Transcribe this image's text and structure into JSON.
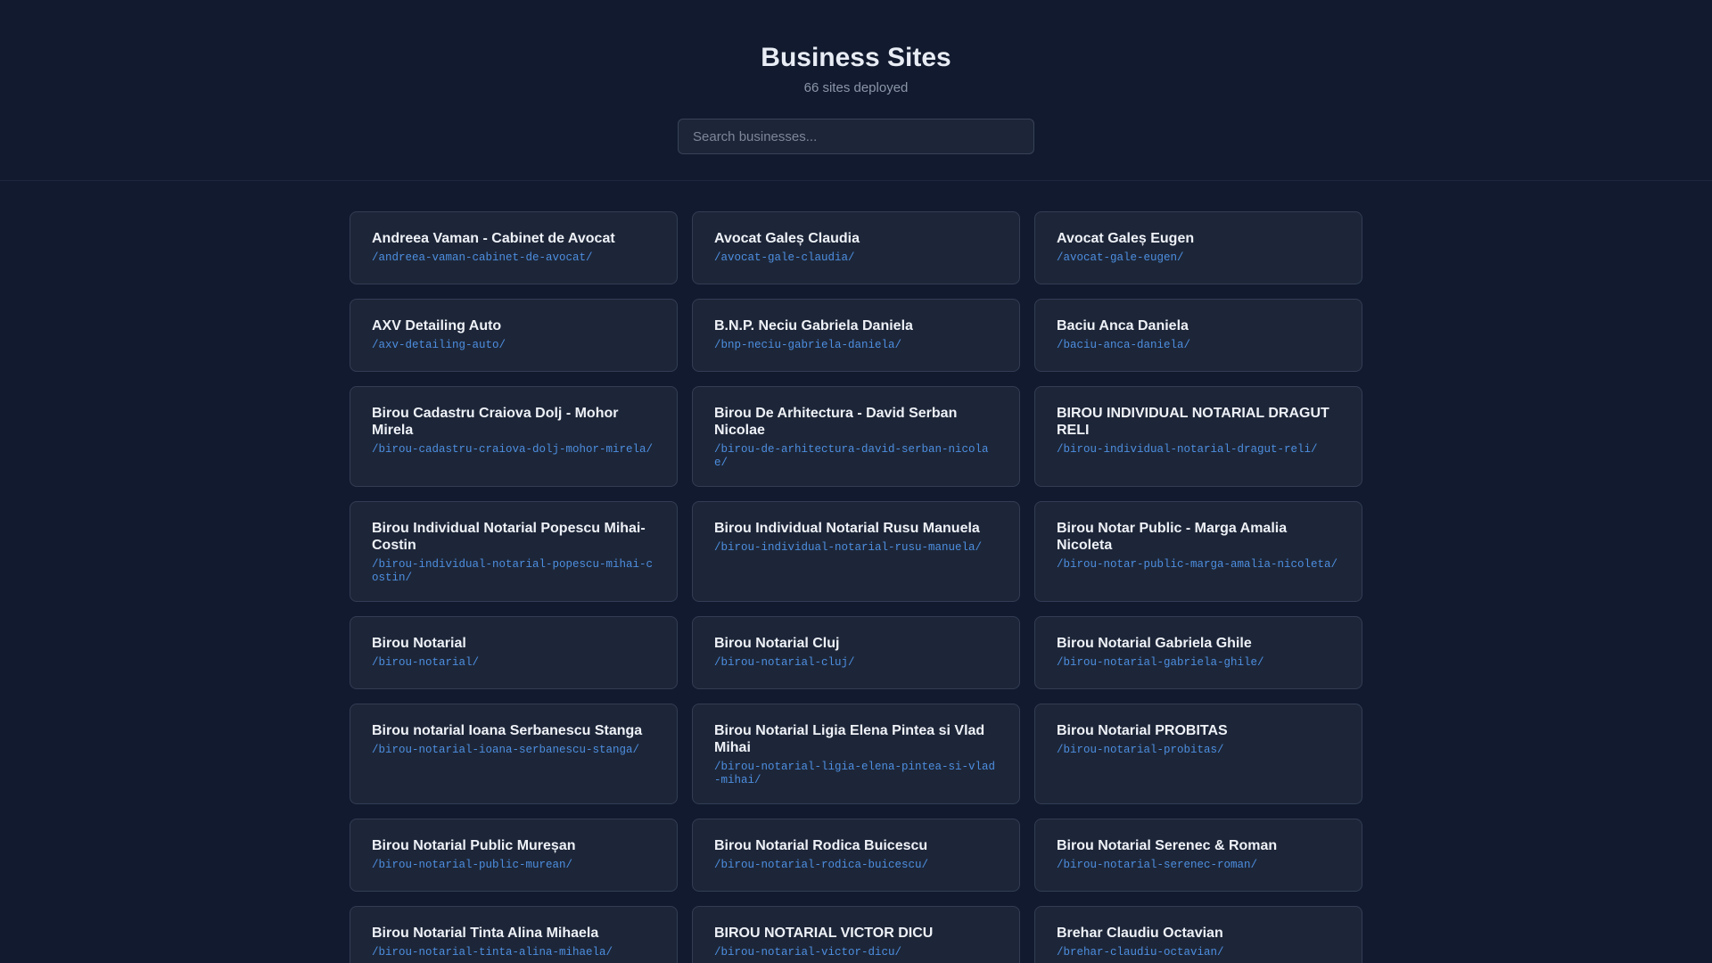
{
  "header": {
    "title": "Business Sites",
    "subtitle": "66 sites deployed"
  },
  "search": {
    "placeholder": "Search businesses..."
  },
  "sites": [
    {
      "name": "Andreea Vaman - Cabinet de Avocat",
      "path": "/andreea-vaman-cabinet-de-avocat/"
    },
    {
      "name": "Avocat Galeș Claudia",
      "path": "/avocat-gale-claudia/"
    },
    {
      "name": "Avocat Galeș Eugen",
      "path": "/avocat-gale-eugen/"
    },
    {
      "name": "AXV Detailing Auto",
      "path": "/axv-detailing-auto/"
    },
    {
      "name": "B.N.P. Neciu Gabriela Daniela",
      "path": "/bnp-neciu-gabriela-daniela/"
    },
    {
      "name": "Baciu Anca Daniela",
      "path": "/baciu-anca-daniela/"
    },
    {
      "name": "Birou Cadastru Craiova Dolj - Mohor Mirela",
      "path": "/birou-cadastru-craiova-dolj-mohor-mirela/"
    },
    {
      "name": "Birou De Arhitectura - David Serban Nicolae",
      "path": "/birou-de-arhitectura-david-serban-nicolae/"
    },
    {
      "name": "BIROU INDIVIDUAL NOTARIAL DRAGUT RELI",
      "path": "/birou-individual-notarial-dragut-reli/"
    },
    {
      "name": "Birou Individual Notarial Popescu Mihai-Costin",
      "path": "/birou-individual-notarial-popescu-mihai-costin/"
    },
    {
      "name": "Birou Individual Notarial Rusu Manuela",
      "path": "/birou-individual-notarial-rusu-manuela/"
    },
    {
      "name": "Birou Notar Public - Marga Amalia Nicoleta",
      "path": "/birou-notar-public-marga-amalia-nicoleta/"
    },
    {
      "name": "Birou Notarial",
      "path": "/birou-notarial/"
    },
    {
      "name": "Birou Notarial Cluj",
      "path": "/birou-notarial-cluj/"
    },
    {
      "name": "Birou Notarial Gabriela Ghile",
      "path": "/birou-notarial-gabriela-ghile/"
    },
    {
      "name": "Birou notarial Ioana Serbanescu Stanga",
      "path": "/birou-notarial-ioana-serbanescu-stanga/"
    },
    {
      "name": "Birou Notarial Ligia Elena Pintea si Vlad Mihai",
      "path": "/birou-notarial-ligia-elena-pintea-si-vlad-mihai/"
    },
    {
      "name": "Birou Notarial PROBITAS",
      "path": "/birou-notarial-probitas/"
    },
    {
      "name": "Birou Notarial Public Mureșan",
      "path": "/birou-notarial-public-murean/"
    },
    {
      "name": "Birou Notarial Rodica Buicescu",
      "path": "/birou-notarial-rodica-buicescu/"
    },
    {
      "name": "Birou Notarial Serenec & Roman",
      "path": "/birou-notarial-serenec-roman/"
    },
    {
      "name": "Birou Notarial Tinta Alina Mihaela",
      "path": "/birou-notarial-tinta-alina-mihaela/"
    },
    {
      "name": "BIROU NOTARIAL VICTOR DICU",
      "path": "/birou-notarial-victor-dicu/"
    },
    {
      "name": "Brehar Claudiu Octavian",
      "path": "/brehar-claudiu-octavian/"
    }
  ]
}
